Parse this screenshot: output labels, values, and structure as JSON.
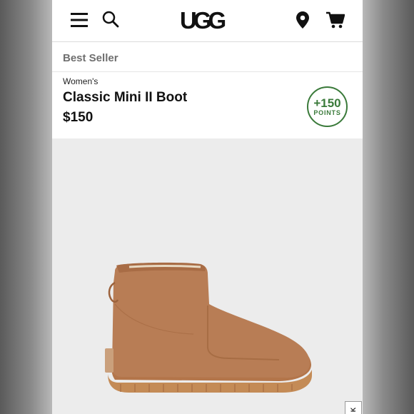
{
  "header": {
    "brand": "UGG",
    "icons": [
      "menu-icon",
      "search-icon",
      "location-pin-icon",
      "cart-icon"
    ]
  },
  "product": {
    "badge": "Best Seller",
    "category": "Women's",
    "name": "Classic Mini II Boot",
    "price": "$150",
    "points": {
      "value": "+150",
      "label": "POINTS"
    }
  },
  "corner_tag": {
    "text": "K"
  },
  "colors": {
    "points_green": "#3a7a3a",
    "boot_tan": "#b87d55",
    "sole": "#c9925f"
  }
}
